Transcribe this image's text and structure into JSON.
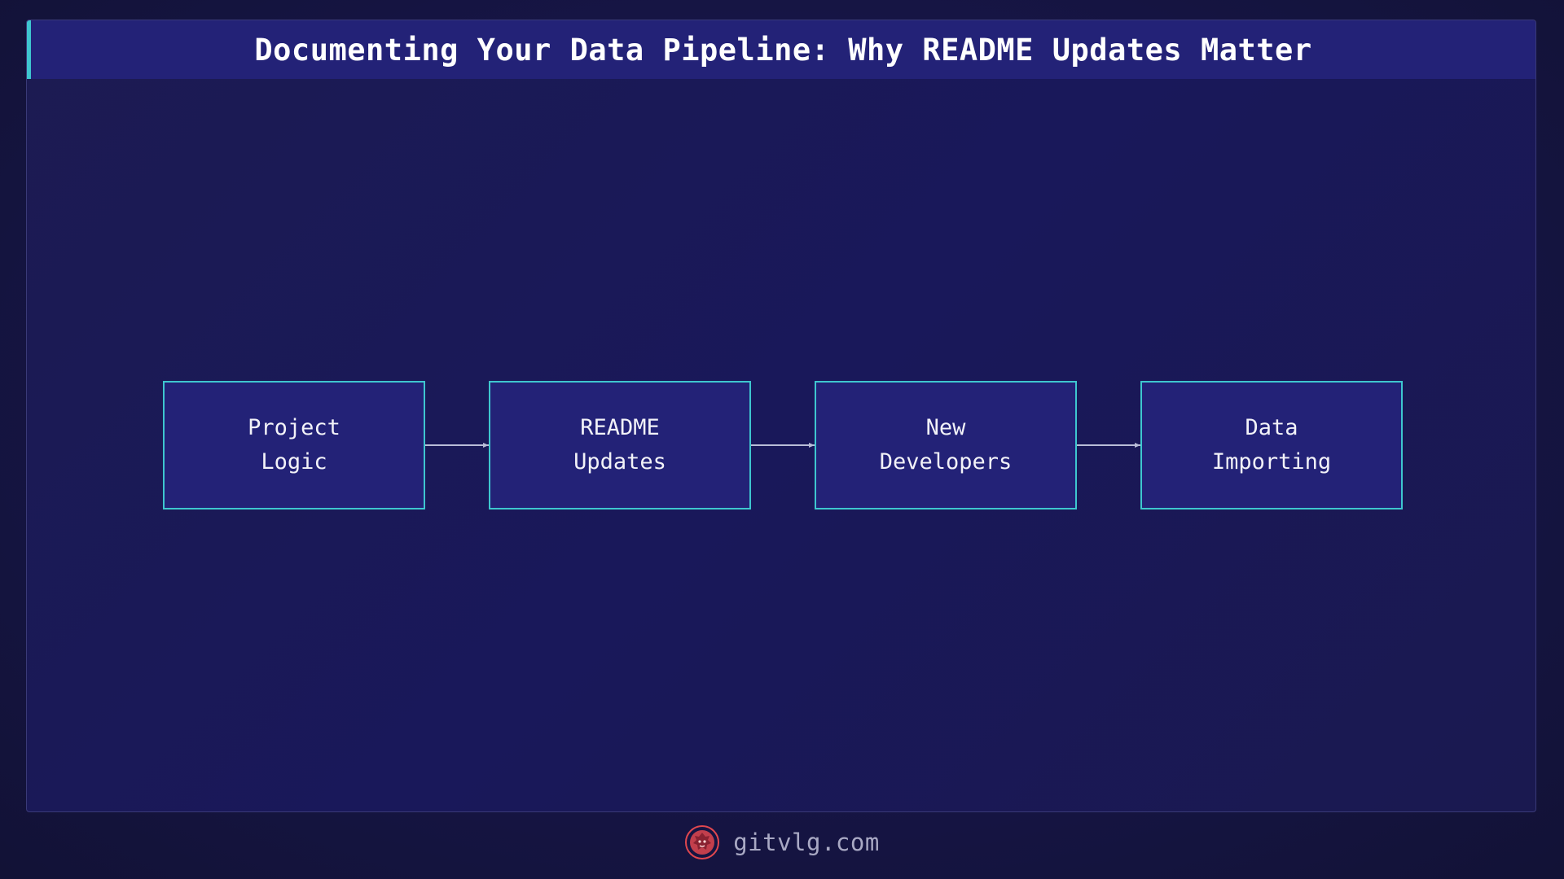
{
  "title": "Documenting Your Data Pipeline: Why README Updates Matter",
  "nodes": [
    {
      "line1": "Project",
      "line2": "Logic"
    },
    {
      "line1": "README",
      "line2": "Updates"
    },
    {
      "line1": "New",
      "line2": "Developers"
    },
    {
      "line1": "Data",
      "line2": "Importing"
    }
  ],
  "footer": {
    "site": "gitvlg.com",
    "logo_icon": "lion-logo-icon"
  },
  "colors": {
    "accent": "#3ec6cf",
    "node_fill": "#232277",
    "logo": "#e0474f"
  }
}
